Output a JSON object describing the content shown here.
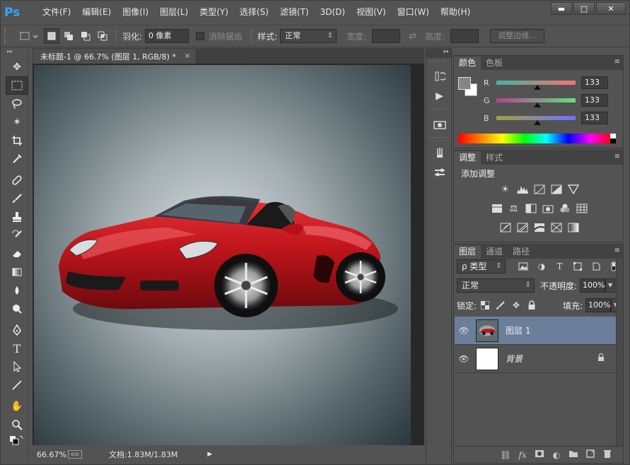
{
  "app": {
    "logo": "Ps"
  },
  "menu": [
    "文件(F)",
    "编辑(E)",
    "图像(I)",
    "图层(L)",
    "类型(Y)",
    "选择(S)",
    "滤镜(T)",
    "3D(D)",
    "视图(V)",
    "窗口(W)",
    "帮助(H)"
  ],
  "window": {
    "minimize": "▬",
    "maximize": "□",
    "close": "✕"
  },
  "options": {
    "feather_label": "羽化:",
    "feather_value": "0 像素",
    "antialias_label": "消除锯齿",
    "style_label": "样式:",
    "style_value": "正常",
    "width_label": "宽度:",
    "height_label": "高度:",
    "refine_edge": "调整边缘..."
  },
  "document": {
    "tab_title": "未标题-1 @ 66.7% (图层 1, RGB/8) *",
    "tab_close": "×",
    "zoom": "66.67%",
    "doc_info": "文档:1.83M/1.83M"
  },
  "color_panel": {
    "tabs": [
      "颜色",
      "色板"
    ],
    "sliders": [
      {
        "label": "R",
        "value": "133",
        "fraction": 0.52,
        "from": "#3cb4a8",
        "to": "#ff7070"
      },
      {
        "label": "G",
        "value": "133",
        "fraction": 0.52,
        "from": "#b44090",
        "to": "#60e080"
      },
      {
        "label": "B",
        "value": "133",
        "fraction": 0.52,
        "from": "#a0a040",
        "to": "#7070ff"
      }
    ],
    "foreground": "#858585",
    "background": "#ffffff"
  },
  "adjust_panel": {
    "tabs": [
      "调整",
      "样式"
    ],
    "title": "添加调整"
  },
  "layers_panel": {
    "tabs": [
      "图层",
      "通道",
      "路径"
    ],
    "filter_label": "ρ 类型",
    "blend_mode": "正常",
    "opacity_label": "不透明度:",
    "opacity_value": "100%",
    "lock_label": "锁定:",
    "fill_label": "填充:",
    "fill_value": "100%",
    "layers": [
      {
        "name": "图层 1",
        "selected": true
      },
      {
        "name": "背景",
        "selected": false
      }
    ]
  },
  "colors": {
    "selected_layer": "#6b7f9b",
    "panel_bg": "#535353",
    "car": "#c0151b"
  }
}
